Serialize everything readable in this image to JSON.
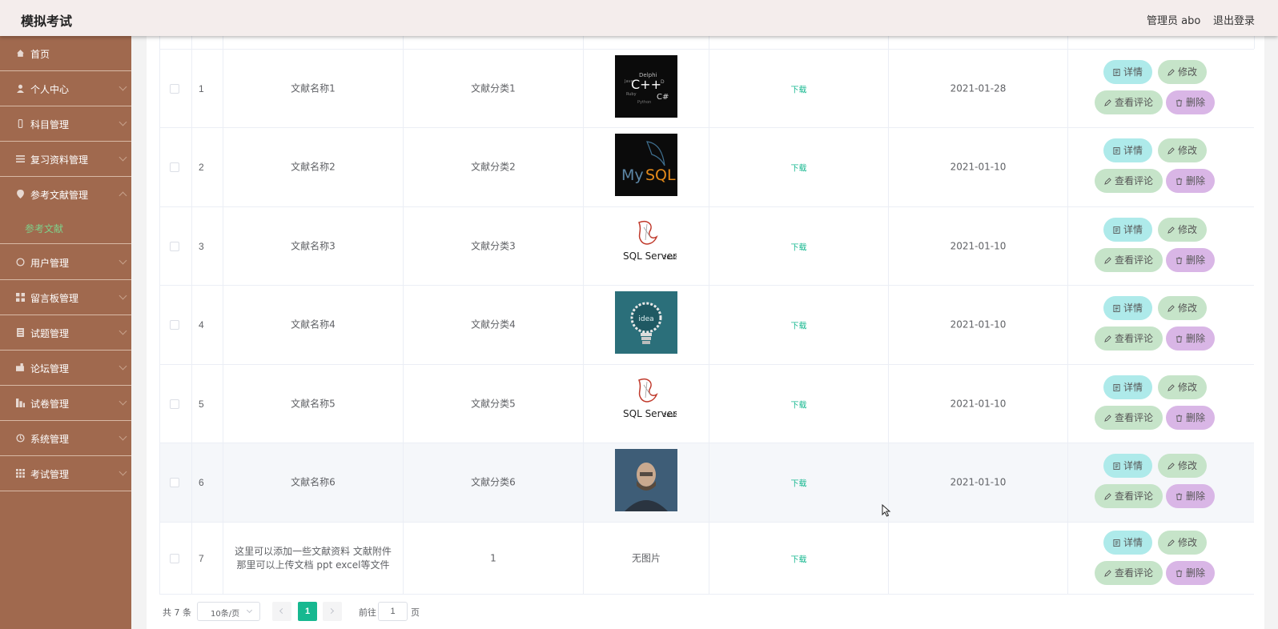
{
  "header": {
    "app_title": "模拟考试",
    "user_label": "管理员 abo",
    "logout_label": "退出登录"
  },
  "sidebar": {
    "items": [
      {
        "label": "首页",
        "icon": "home-icon"
      },
      {
        "label": "个人中心",
        "icon": "user-icon"
      },
      {
        "label": "科目管理",
        "icon": "phone-icon"
      },
      {
        "label": "复习资料管理",
        "icon": "menu-icon"
      },
      {
        "label": "参考文献管理",
        "icon": "location-icon",
        "expanded": true
      },
      {
        "label": "用户管理",
        "icon": "circle-icon"
      },
      {
        "label": "留言板管理",
        "icon": "grid-icon"
      },
      {
        "label": "试题管理",
        "icon": "list-icon"
      },
      {
        "label": "论坛管理",
        "icon": "chat-icon"
      },
      {
        "label": "试卷管理",
        "icon": "bar-icon"
      },
      {
        "label": "系统管理",
        "icon": "settings-icon"
      },
      {
        "label": "考试管理",
        "icon": "apps-icon"
      }
    ],
    "active_submenu": "参考文献"
  },
  "table": {
    "rows": [
      {
        "index": "1",
        "name": "文献名称1",
        "category": "文献分类1",
        "image": "cpp-wordcloud",
        "file": "下载",
        "date": "2021-01-28"
      },
      {
        "index": "2",
        "name": "文献名称2",
        "category": "文献分类2",
        "image": "mysql-logo",
        "file": "下载",
        "date": "2021-01-10"
      },
      {
        "index": "3",
        "name": "文献名称3",
        "category": "文献分类3",
        "image": "sqlserver-logo",
        "file": "下载",
        "date": "2021-01-10"
      },
      {
        "index": "4",
        "name": "文献名称4",
        "category": "文献分类4",
        "image": "idea-bulb",
        "file": "下载",
        "date": "2021-01-10"
      },
      {
        "index": "5",
        "name": "文献名称5",
        "category": "文献分类5",
        "image": "sqlserver-logo",
        "file": "下载",
        "date": "2021-01-10"
      },
      {
        "index": "6",
        "name": "文献名称6",
        "category": "文献分类6",
        "image": "programmer-photo",
        "file": "下载",
        "date": "2021-01-10"
      },
      {
        "index": "7",
        "name": "这里可以添加一些文献资料 文献附件那里可以上传文档 ppt excel等文件",
        "category": "1",
        "image": "none",
        "image_text": "无图片",
        "file": "下载",
        "date": ""
      }
    ],
    "actions": {
      "detail": "详情",
      "edit": "修改",
      "comments": "查看评论",
      "delete": "删除"
    }
  },
  "pagination": {
    "total": "共 7 条",
    "page_size": "10条/页",
    "current_page": "1",
    "goto_label": "前往",
    "goto_value": "1",
    "page_suffix": "页"
  },
  "colors": {
    "sidebar": "#a0694e",
    "accent": "#17b890",
    "active_submenu": "#7ed08a"
  }
}
